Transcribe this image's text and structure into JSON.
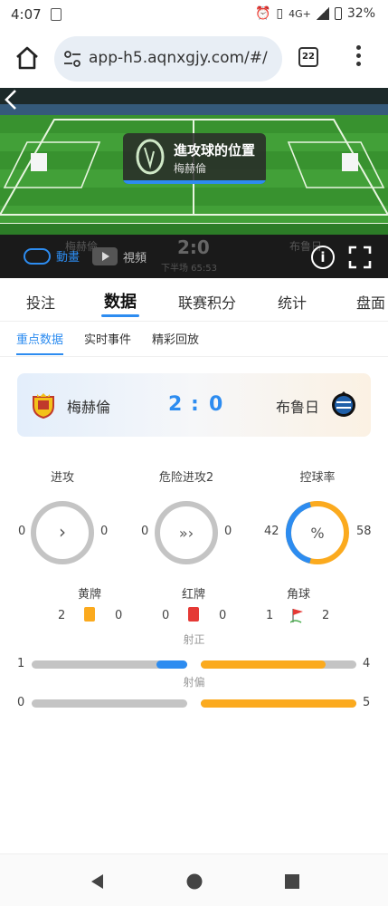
{
  "status_bar": {
    "time": "4:07",
    "network": "4G+",
    "battery": "32%"
  },
  "browser": {
    "url": "app-h5.aqnxgjy.com/#/",
    "tab_count": "22"
  },
  "event": {
    "title": "進攻球的位置",
    "team": "梅赫倫"
  },
  "video_bar": {
    "animation_label": "動畫",
    "video_label": "視頻",
    "ghost_score": "2:0",
    "ghost_home": "梅赫倫",
    "ghost_away": "布鲁日",
    "ghost_time": "下半场 65:53"
  },
  "main_tabs": [
    "投注",
    "数据",
    "联赛积分",
    "统计",
    "盘面"
  ],
  "active_main_tab": "数据",
  "sub_tabs": [
    "重点数据",
    "实时事件",
    "精彩回放"
  ],
  "active_sub_tab": "重点数据",
  "match": {
    "home": "梅赫倫",
    "away": "布鲁日",
    "home_score": "2",
    "sep": ":",
    "away_score": "0"
  },
  "colors": {
    "home": "#2d8cf0",
    "away": "#fbaa1e",
    "neutral": "#c4c4c4"
  },
  "ring_stats": [
    {
      "title": "进攻",
      "home": "0",
      "away": "0",
      "icon": "chevron-right-icon",
      "glyph": "›"
    },
    {
      "title": "危险进攻2",
      "home": "0",
      "away": "0",
      "icon": "triple-chevron-icon",
      "glyph": "»›"
    },
    {
      "title": "控球率",
      "home": "42",
      "away": "58",
      "icon": "percent-icon",
      "glyph": "%",
      "home_share": 0.42
    }
  ],
  "card_stats": [
    {
      "title": "黄牌",
      "home": "2",
      "away": "0",
      "icon": "yellow-card-icon"
    },
    {
      "title": "红牌",
      "home": "0",
      "away": "0",
      "icon": "red-card-icon"
    },
    {
      "title": "角球",
      "home": "1",
      "away": "2",
      "icon": "corner-flag-icon"
    }
  ],
  "bar_stats": [
    {
      "title": "射正",
      "home": "1",
      "away": "4",
      "home_value": 1,
      "away_value": 4
    },
    {
      "title": "射偏",
      "home": "0",
      "away": "5",
      "home_value": 0,
      "away_value": 5
    }
  ]
}
